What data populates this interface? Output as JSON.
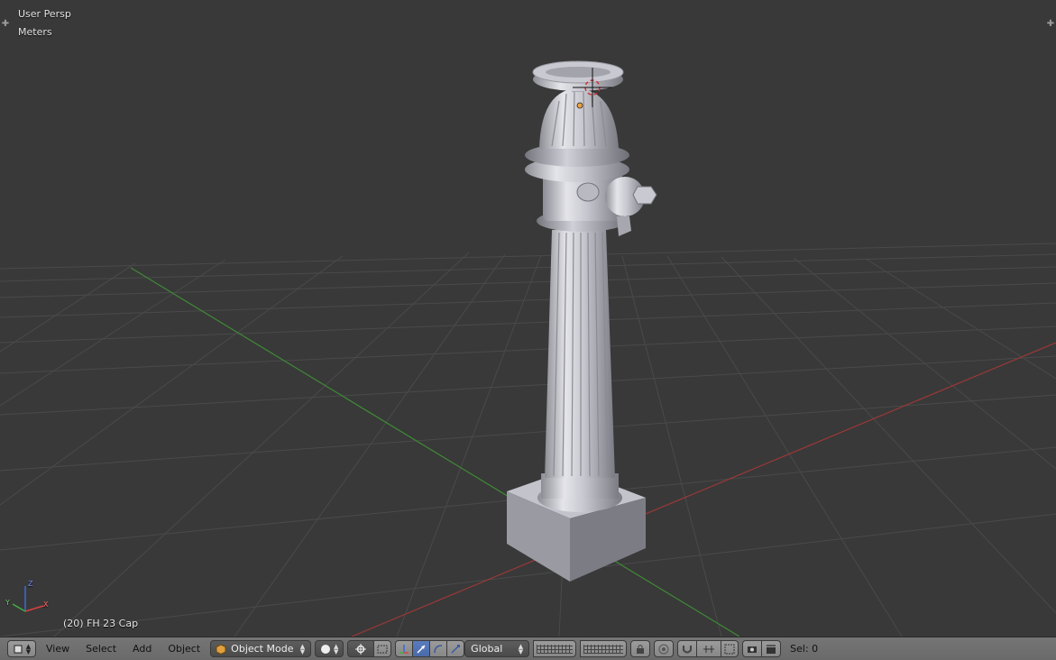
{
  "viewport": {
    "view_name": "User Persp",
    "units": "Meters",
    "object_info": "(20) FH 23 Cap",
    "axis_labels": {
      "x": "X",
      "y": "Y",
      "z": "Z"
    }
  },
  "header": {
    "editor_type_icon": "3d-view-icon",
    "menus": {
      "view": "View",
      "select": "Select",
      "add": "Add",
      "object": "Object"
    },
    "mode": {
      "label": "Object Mode",
      "icon": "cube-icon"
    },
    "shading_icon": "sphere-solid-icon",
    "pivot_icon": "pivot-point-icon",
    "manipulator_icons": [
      "manipulator-toggle-icon",
      "translate-icon",
      "rotate-icon",
      "scale-icon"
    ],
    "orientation": "Global",
    "layers_icon": "layers-grid-icon",
    "selection_status": "Sel: 0"
  },
  "colors": {
    "viewport_bg": "#393939",
    "grid_line": "#4a4a4a",
    "x_axis": "#9a3838",
    "y_axis": "#3f8a36",
    "header_bg": "#727272",
    "active_button": "#5a7cc0"
  }
}
